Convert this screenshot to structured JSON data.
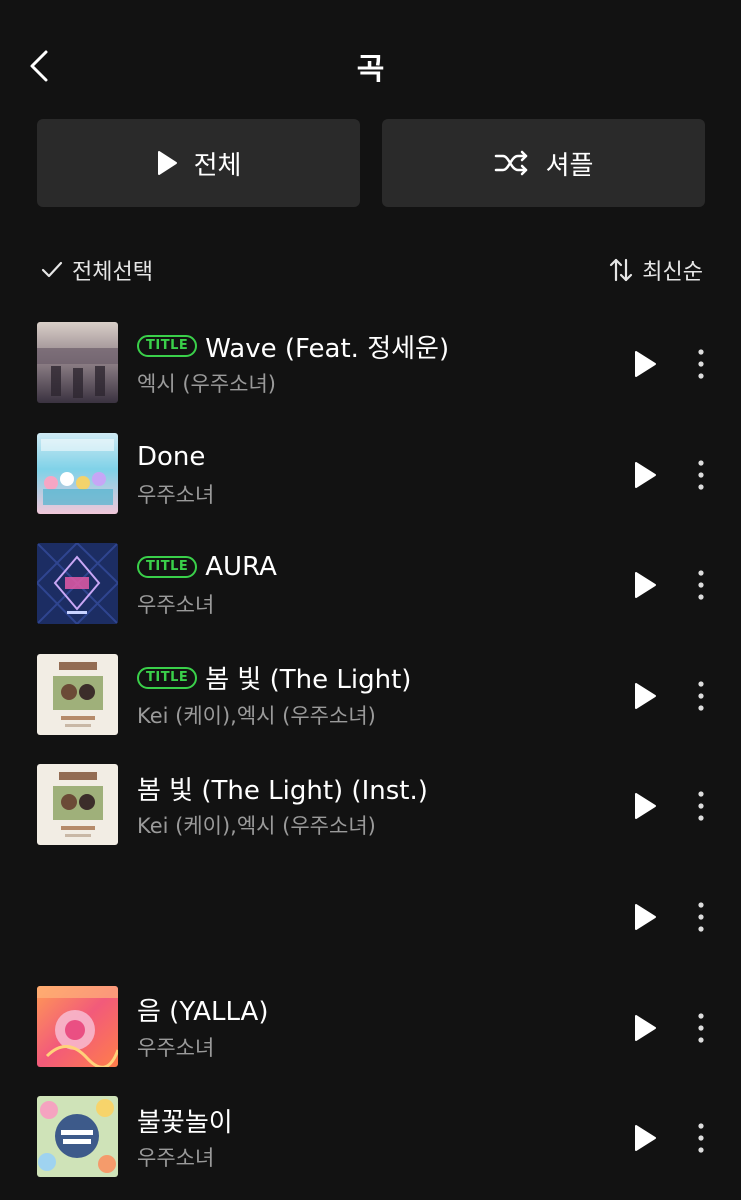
{
  "header": {
    "title": "곡",
    "back_icon": "chevron-left-icon"
  },
  "actions": {
    "play_all": {
      "label": "전체",
      "icon": "play-icon"
    },
    "shuffle": {
      "label": "셔플",
      "icon": "shuffle-icon"
    }
  },
  "toolbar": {
    "select_all": {
      "label": "전체선택",
      "icon": "check-icon"
    },
    "sort": {
      "label": "최신순",
      "icon": "sort-icon"
    }
  },
  "badge_label": "TITLE",
  "colors": {
    "accent": "#3ad04a",
    "background": "#121212",
    "button_bg": "#2a2a2a",
    "secondary_text": "#9a9a9a"
  },
  "songs": [
    {
      "title": "Wave (Feat. 정세운)",
      "artist": "엑시 (우주소녀)",
      "is_title": true
    },
    {
      "title": "Done",
      "artist": "우주소녀",
      "is_title": false
    },
    {
      "title": "AURA",
      "artist": "우주소녀",
      "is_title": true
    },
    {
      "title": "봄 빛 (The Light)",
      "artist": "Kei (케이),엑시 (우주소녀)",
      "is_title": true
    },
    {
      "title": "봄 빛 (The Light) (Inst.)",
      "artist": "Kei (케이),엑시 (우주소녀)",
      "is_title": false
    },
    {
      "title": "",
      "artist": "",
      "is_title": false
    },
    {
      "title": "음 (YALLA)",
      "artist": "우주소녀",
      "is_title": false
    },
    {
      "title": "불꽃놀이",
      "artist": "우주소녀",
      "is_title": false
    }
  ]
}
